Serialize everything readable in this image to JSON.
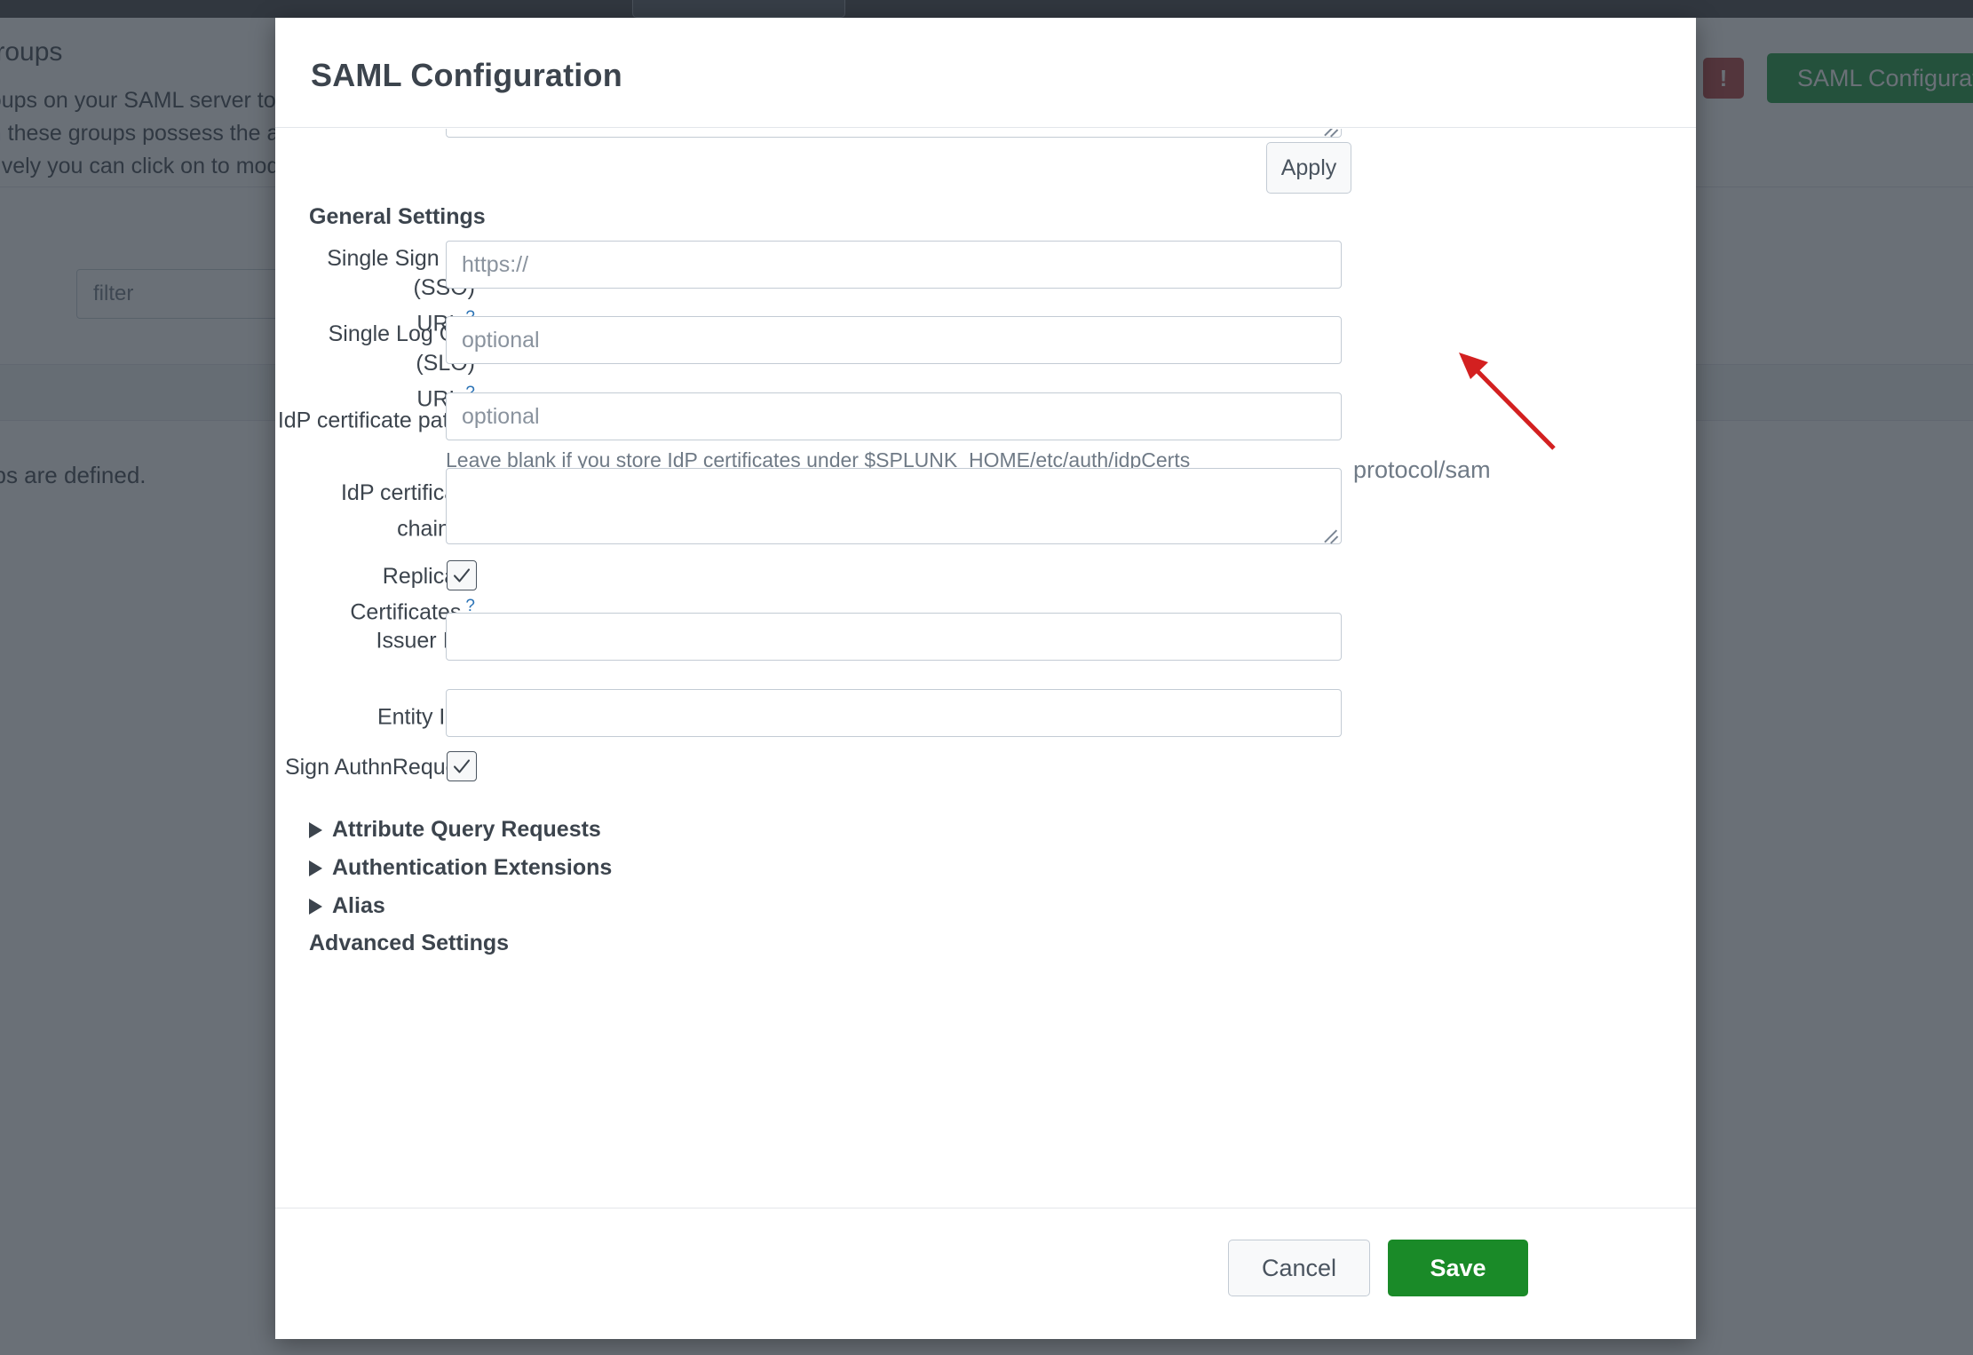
{
  "background": {
    "heading": "Groups",
    "paragraph": "Map groups on your SAML server to roles in Splunk Enterprise.\nUsers in these groups possess the abilities of their mapped roles.\nAlternatively you can click on to modify your existing groups.",
    "filter_placeholder": "filter",
    "empty_text": "No groups are defined.",
    "alert_badge": "!",
    "green_button": "SAML Configuration",
    "ghost_text": "protocol/sam"
  },
  "modal": {
    "title": "SAML Configuration",
    "close_icon": "close-icon",
    "apply_label": "Apply",
    "section_general": "General Settings",
    "clipped_section": "Advanced Settings",
    "fields": [
      {
        "label": "Single Sign On (SSO)\nURL",
        "help": "?",
        "placeholder": "https://",
        "value": ""
      },
      {
        "label": "Single Log Out (SLO)\nURL",
        "help": "?",
        "placeholder": "optional",
        "value": ""
      },
      {
        "label": "IdP certificate path",
        "help": "?",
        "placeholder": "optional",
        "value": "",
        "hint": "Leave blank if you store IdP certificates under $SPLUNK_HOME/etc/auth/idpCerts"
      },
      {
        "label": "IdP certificate chains",
        "help": "?",
        "placeholder": "",
        "value": ""
      },
      {
        "label": "Issuer Id",
        "help": "?",
        "placeholder": "",
        "value": ""
      },
      {
        "label": "Entity ID",
        "help": "?",
        "placeholder": "",
        "value": ""
      }
    ],
    "checkboxes": [
      {
        "label": "Replicate Certificates",
        "help": "?",
        "checked": true
      },
      {
        "label": "Sign AuthnRequest",
        "help": "",
        "checked": true
      }
    ],
    "collapsibles": [
      {
        "label": "Attribute Query Requests",
        "expanded": false
      },
      {
        "label": "Authentication Extensions",
        "expanded": false
      },
      {
        "label": "Alias",
        "expanded": false
      }
    ],
    "footer": {
      "cancel_label": "Cancel",
      "save_label": "Save"
    }
  },
  "colors": {
    "save_green": "#1a8a28",
    "accent_blue": "#2a72b5",
    "text_dark": "#3c444d",
    "overlay": "#2b333d",
    "arrow_red": "#d32020",
    "alert_red": "#b33a3a"
  }
}
